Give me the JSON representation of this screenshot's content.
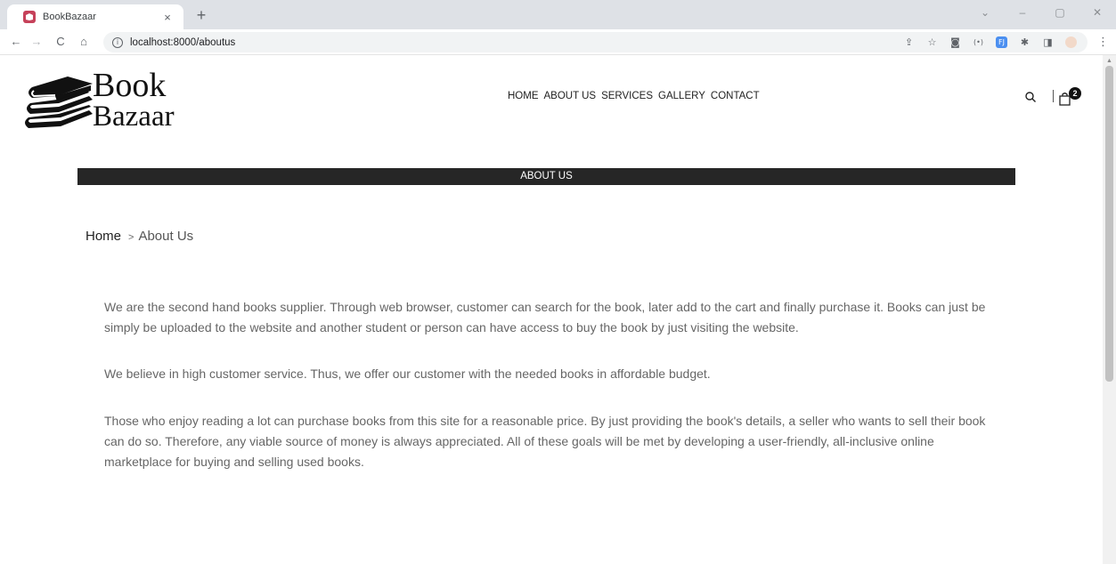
{
  "browser": {
    "tab_title": "BookBazaar",
    "tab_close": "×",
    "new_tab": "+",
    "url": "localhost:8000/aboutus",
    "nav": {
      "back": "←",
      "forward": "→",
      "reload": "C",
      "home": "⌂"
    },
    "window_controls": {
      "minimize_chevron": "⌄",
      "minimize": "–",
      "restore": "▢",
      "close": "✕"
    },
    "extensions": [
      "share-icon",
      "star-icon",
      "camera-icon",
      "radio-icon",
      "extension-blue-icon",
      "puzzle-icon",
      "sidepanel-icon",
      "profile-avatar"
    ]
  },
  "site": {
    "logo": {
      "line1": "Book",
      "line2": "Bazaar"
    },
    "nav": {
      "home": "HOME",
      "about": "ABOUT US",
      "services": "SERVICES",
      "gallery": "GALLERY",
      "contact": "CONTACT"
    },
    "cart_count": "2"
  },
  "page": {
    "banner": "ABOUT US",
    "breadcrumb": {
      "home": "Home",
      "separator": ">",
      "current": "About Us"
    },
    "paragraphs": [
      "We are the second hand books supplier. Through web browser, customer can search for the book, later add to the cart and finally purchase it. Books can just be simply be uploaded to the website and another student or person can have access to buy the book by just visiting the website.",
      "We believe in high customer service. Thus, we offer our customer with the needed books in affordable budget.",
      "Those who enjoy reading a lot can purchase books from this site for a reasonable price. By just providing the book's details, a seller who wants to sell their book can do so. Therefore, any viable source of money is always appreciated. All of these goals will be met by developing a user-friendly, all-inclusive online marketplace for buying and selling used books."
    ]
  },
  "colors": {
    "banner_bg": "#262626",
    "text": "#666666",
    "tab_strip": "#dee1e6"
  }
}
